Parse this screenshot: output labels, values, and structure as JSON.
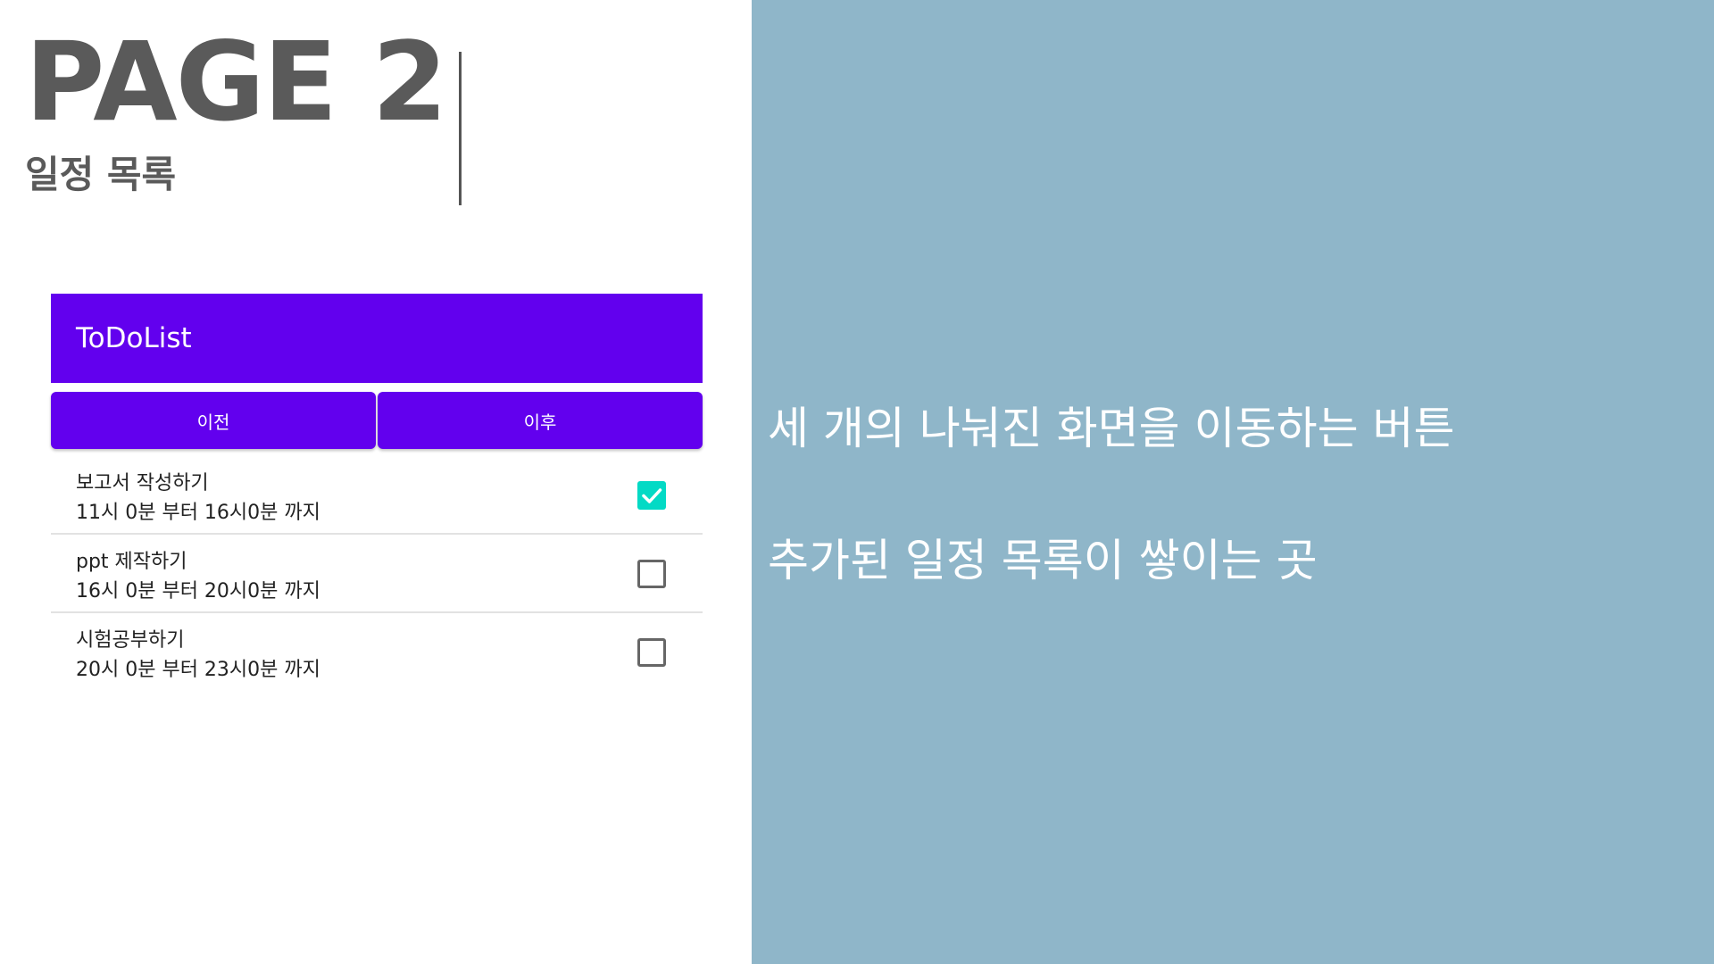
{
  "slide": {
    "title": "PAGE 2",
    "subtitle": "일정 목록"
  },
  "app": {
    "app_bar_title": "ToDoList",
    "nav": {
      "prev_label": "이전",
      "next_label": "이후"
    },
    "todos": [
      {
        "title": "보고서 작성하기",
        "time": "11시 0분 부터 16시0분 까지",
        "checked": true
      },
      {
        "title": "ppt 제작하기",
        "time": "16시 0분 부터 20시0분 까지",
        "checked": false
      },
      {
        "title": "시험공부하기",
        "time": "20시 0분 부터 23시0분 까지",
        "checked": false
      }
    ]
  },
  "annotations": {
    "nav_buttons_note": "세 개의 나눠진 화면을 이동하는 버튼",
    "list_note": "추가된 일정 목록이 쌓이는 곳"
  },
  "colors": {
    "app_bar": "#6200ee",
    "checkbox_checked": "#03dac5",
    "right_panel": "#8fb6c9",
    "title_text": "#5a5a5a"
  }
}
